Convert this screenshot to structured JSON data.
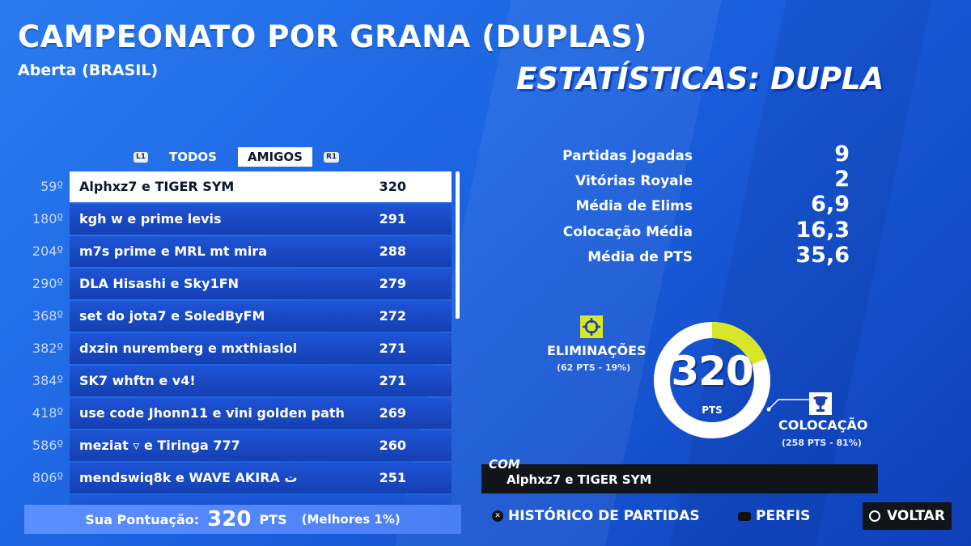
{
  "header": {
    "title": "CAMPEONATO POR GRANA (DUPLAS)",
    "subtitle": "Aberta (BRASIL)",
    "stats_title": "ESTATÍSTICAS: DUPLA"
  },
  "tabs": {
    "left_key": "L1",
    "right_key": "R1",
    "items": [
      {
        "label": "TODOS"
      },
      {
        "label": "AMIGOS",
        "active": true
      }
    ]
  },
  "leaderboard": {
    "rows": [
      {
        "rank": "59º",
        "name": "Alphxz7 e TIGER SYM",
        "points": "320",
        "selected": true
      },
      {
        "rank": "180º",
        "name": "kgh w e prime levis",
        "points": "291"
      },
      {
        "rank": "204º",
        "name": "m7s prime e MRL mt mira",
        "points": "288"
      },
      {
        "rank": "290º",
        "name": "DLA Hisashi e Sky1FN",
        "points": "279"
      },
      {
        "rank": "368º",
        "name": "set do jota7 e SoledByFM",
        "points": "272"
      },
      {
        "rank": "382º",
        "name": "dxzin nuremberg e mxthiaslol",
        "points": "271"
      },
      {
        "rank": "384º",
        "name": "SK7 whftn e v4!",
        "points": "271"
      },
      {
        "rank": "418º",
        "name": "use code Jhonn11 e vini golden path",
        "points": "269"
      },
      {
        "rank": "586º",
        "name": "meziat ▿ e Tiringa 777",
        "points": "260"
      },
      {
        "rank": "806º",
        "name": "mendswiq8k e WAVE AKIRA ت",
        "points": "251"
      }
    ]
  },
  "score": {
    "label": "Sua Pontuação:",
    "value": "320",
    "unit": "PTS",
    "best": "(Melhores 1%)"
  },
  "stats": [
    {
      "label": "Partidas Jogadas",
      "value": "9"
    },
    {
      "label": "Vitórias Royale",
      "value": "2"
    },
    {
      "label": "Média de Elims",
      "value": "6,9"
    },
    {
      "label": "Colocação Média",
      "value": "16,3"
    },
    {
      "label": "Média de PTS",
      "value": "35,6"
    }
  ],
  "breakdown": {
    "total": "320",
    "unit": "PTS",
    "elims_fraction": 0.19,
    "elims_title": "ELIMINAÇÕES",
    "elims_sub": "(62 PTS - 19%)",
    "placement_title": "COLOCAÇÃO",
    "placement_sub": "(258 PTS - 81%)",
    "elims_color": "#d8e62a",
    "placement_color": "#ffffff"
  },
  "team": {
    "tag": "COM",
    "name": "Alphxz7 e TIGER SYM"
  },
  "footer": {
    "history_label": "HISTÓRICO DE PARTIDAS",
    "profiles_label": "PERFIS",
    "back_label": "VOLTAR"
  }
}
